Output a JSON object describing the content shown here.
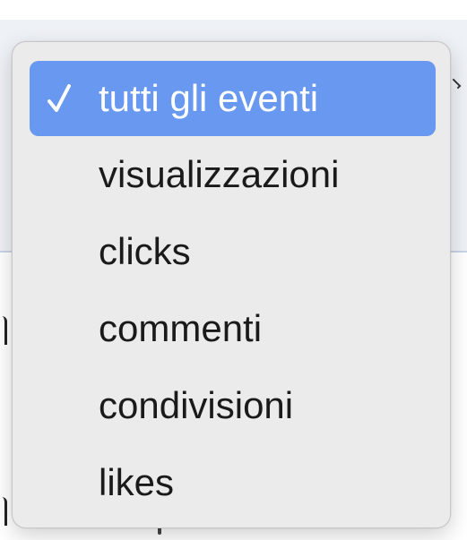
{
  "menu": {
    "items": [
      {
        "label": "tutti gli eventi",
        "selected": true
      },
      {
        "label": "visualizzazioni",
        "selected": false
      },
      {
        "label": "clicks",
        "selected": false
      },
      {
        "label": "commenti",
        "selected": false
      },
      {
        "label": "condivisioni",
        "selected": false
      },
      {
        "label": "likes",
        "selected": false
      }
    ],
    "check_icon": "checkmark-icon"
  },
  "colors": {
    "selection_highlight": "#6898f0",
    "menu_background": "#ebebeb",
    "text": "#1a1a1a",
    "selected_text": "#ffffff"
  }
}
